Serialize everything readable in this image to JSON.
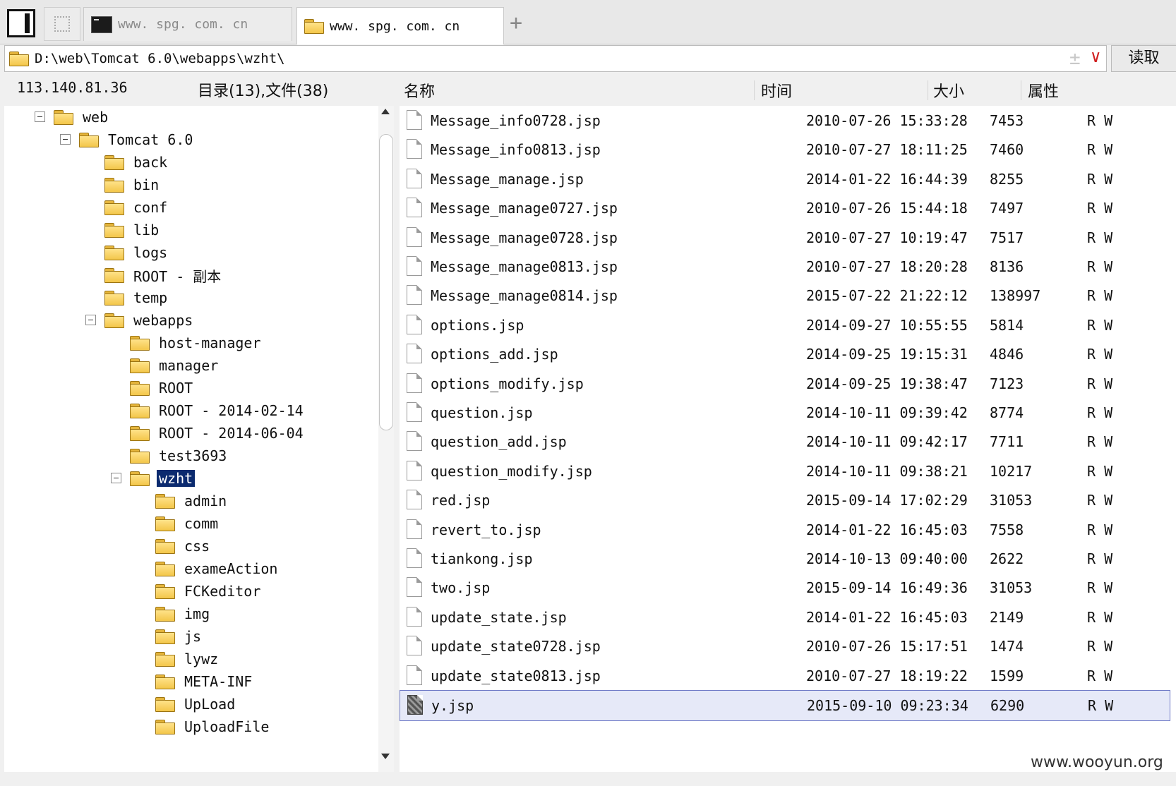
{
  "tabs": [
    {
      "label": "www. spg. com. cn",
      "icon": "terminal-icon",
      "active": false
    },
    {
      "label": "www. spg. com. cn",
      "icon": "folder-icon",
      "active": true
    }
  ],
  "address": {
    "path": "D:\\web\\Tomcat 6.0\\webapps\\wzht\\",
    "read_label": "读取"
  },
  "info": {
    "ip": "113.140.81.36",
    "counts": "目录(13),文件(38)"
  },
  "columns": {
    "name": "名称",
    "time": "时间",
    "size": "大小",
    "attr": "属性"
  },
  "tree": [
    {
      "label": "web",
      "depth": 0,
      "expanded": true
    },
    {
      "label": "Tomcat 6.0",
      "depth": 1,
      "expanded": true
    },
    {
      "label": "back",
      "depth": 2
    },
    {
      "label": "bin",
      "depth": 2
    },
    {
      "label": "conf",
      "depth": 2
    },
    {
      "label": "lib",
      "depth": 2
    },
    {
      "label": "logs",
      "depth": 2
    },
    {
      "label": "ROOT - 副本",
      "depth": 2
    },
    {
      "label": "temp",
      "depth": 2
    },
    {
      "label": "webapps",
      "depth": 2,
      "expanded": true
    },
    {
      "label": "host-manager",
      "depth": 3
    },
    {
      "label": "manager",
      "depth": 3
    },
    {
      "label": "ROOT",
      "depth": 3
    },
    {
      "label": "ROOT - 2014-02-14",
      "depth": 3
    },
    {
      "label": "ROOT - 2014-06-04",
      "depth": 3
    },
    {
      "label": "test3693",
      "depth": 3
    },
    {
      "label": "wzht",
      "depth": 3,
      "expanded": true,
      "selected": true
    },
    {
      "label": "admin",
      "depth": 4
    },
    {
      "label": "comm",
      "depth": 4
    },
    {
      "label": "css",
      "depth": 4
    },
    {
      "label": "exameAction",
      "depth": 4
    },
    {
      "label": "FCKeditor",
      "depth": 4
    },
    {
      "label": "img",
      "depth": 4
    },
    {
      "label": "js",
      "depth": 4
    },
    {
      "label": "lywz",
      "depth": 4
    },
    {
      "label": "META-INF",
      "depth": 4
    },
    {
      "label": "UpLoad",
      "depth": 4
    },
    {
      "label": "UploadFile",
      "depth": 4
    }
  ],
  "files": [
    {
      "name": "Message_info0728.jsp",
      "time": "2010-07-26 15:33:28",
      "size": "7453",
      "attr": "R W"
    },
    {
      "name": "Message_info0813.jsp",
      "time": "2010-07-27 18:11:25",
      "size": "7460",
      "attr": "R W"
    },
    {
      "name": "Message_manage.jsp",
      "time": "2014-01-22 16:44:39",
      "size": "8255",
      "attr": "R W"
    },
    {
      "name": "Message_manage0727.jsp",
      "time": "2010-07-26 15:44:18",
      "size": "7497",
      "attr": "R W"
    },
    {
      "name": "Message_manage0728.jsp",
      "time": "2010-07-27 10:19:47",
      "size": "7517",
      "attr": "R W"
    },
    {
      "name": "Message_manage0813.jsp",
      "time": "2010-07-27 18:20:28",
      "size": "8136",
      "attr": "R W"
    },
    {
      "name": "Message_manage0814.jsp",
      "time": "2015-07-22 21:22:12",
      "size": "138997",
      "attr": "R W"
    },
    {
      "name": "options.jsp",
      "time": "2014-09-27 10:55:55",
      "size": "5814",
      "attr": "R W"
    },
    {
      "name": "options_add.jsp",
      "time": "2014-09-25 19:15:31",
      "size": "4846",
      "attr": "R W"
    },
    {
      "name": "options_modify.jsp",
      "time": "2014-09-25 19:38:47",
      "size": "7123",
      "attr": "R W"
    },
    {
      "name": "question.jsp",
      "time": "2014-10-11 09:39:42",
      "size": "8774",
      "attr": "R W"
    },
    {
      "name": "question_add.jsp",
      "time": "2014-10-11 09:42:17",
      "size": "7711",
      "attr": "R W"
    },
    {
      "name": "question_modify.jsp",
      "time": "2014-10-11 09:38:21",
      "size": "10217",
      "attr": "R W"
    },
    {
      "name": "red.jsp",
      "time": "2015-09-14 17:02:29",
      "size": "31053",
      "attr": "R W"
    },
    {
      "name": "revert_to.jsp",
      "time": "2014-01-22 16:45:03",
      "size": "7558",
      "attr": "R W"
    },
    {
      "name": "tiankong.jsp",
      "time": "2014-10-13 09:40:00",
      "size": "2622",
      "attr": "R W"
    },
    {
      "name": "two.jsp",
      "time": "2015-09-14 16:49:36",
      "size": "31053",
      "attr": "R W"
    },
    {
      "name": "update_state.jsp",
      "time": "2014-01-22 16:45:03",
      "size": "2149",
      "attr": "R W"
    },
    {
      "name": "update_state0728.jsp",
      "time": "2010-07-26 15:17:51",
      "size": "1474",
      "attr": "R W"
    },
    {
      "name": "update_state0813.jsp",
      "time": "2010-07-27 18:19:22",
      "size": "1599",
      "attr": "R W"
    },
    {
      "name": "y.jsp",
      "time": "2015-09-10 09:23:34",
      "size": "6290",
      "attr": "R W",
      "selected": true,
      "icon": "binary-file-icon"
    }
  ],
  "watermark": "www.wooyun.org"
}
